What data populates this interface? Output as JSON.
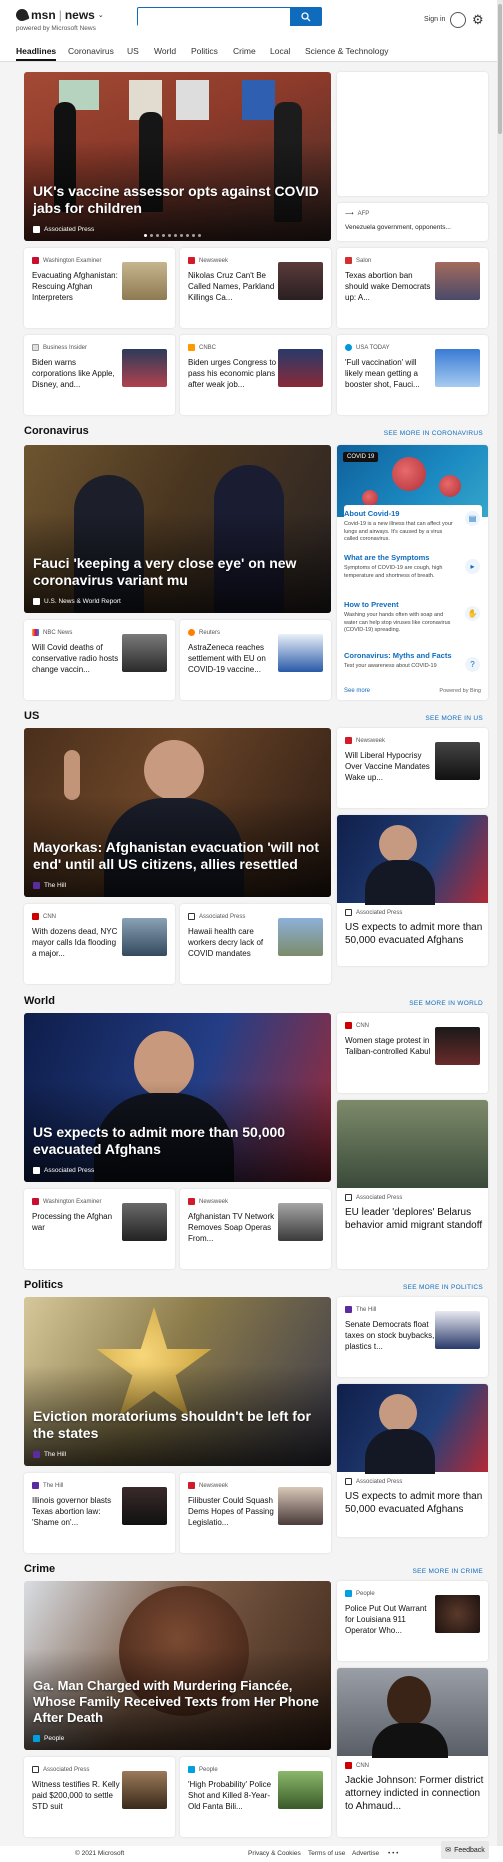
{
  "header": {
    "brand": "msn",
    "section": "news",
    "powered": "powered by Microsoft News",
    "search_placeholder": "",
    "signin": "Sign in"
  },
  "nav": [
    "Headlines",
    "Coronavirus",
    "US",
    "World",
    "Politics",
    "Crime",
    "Local",
    "Science & Technology"
  ],
  "top": {
    "hero": {
      "title": "UK's vaccine assessor opts against COVID jabs for children",
      "source": "Associated Press"
    },
    "side": {
      "source": "AFP",
      "title": "Venezuela government, opponents..."
    },
    "cards": [
      {
        "source": "Washington Examiner",
        "title": "Evacuating Afghanistan: Rescuing Afghan Interpreters"
      },
      {
        "source": "Newsweek",
        "title": "Nikolas Cruz Can't Be Called Names, Parkland Killings Ca..."
      },
      {
        "source": "Salon",
        "title": "Texas abortion ban should wake Democrats up: A..."
      },
      {
        "source": "Business Insider",
        "title": "Biden warns corporations like Apple, Disney, and..."
      },
      {
        "source": "CNBC",
        "title": "Biden urges Congress to pass his economic plans after weak job..."
      },
      {
        "source": "USA TODAY",
        "title": "'Full vaccination' will likely mean getting a booster shot, Fauci..."
      }
    ]
  },
  "coronavirus": {
    "heading": "Coronavirus",
    "more": "SEE MORE IN CORONAVIRUS",
    "hero": {
      "title": "Fauci 'keeping a very close eye' on new coronavirus variant mu",
      "source": "U.S. News & World Report"
    },
    "cards": [
      {
        "source": "NBC News",
        "title": "Will Covid deaths of conservative radio hosts change vaccin..."
      },
      {
        "source": "Reuters",
        "title": "AstraZeneca reaches settlement with EU on COVID-19 vaccine..."
      }
    ],
    "panel": {
      "badge": "COVID 19",
      "items": [
        {
          "title": "About Covid-19",
          "desc": "Covid-19 is a new illness that can affect your lungs and airways. It's caused by a virus called coronavirus."
        },
        {
          "title": "What are the Symptoms",
          "desc": "Symptoms of COVID-19 are cough, high temperature and shortness of breath."
        },
        {
          "title": "How to Prevent",
          "desc": "Washing your hands often with soap and water can help stop viruses like coronavirus (COVID-19) spreading."
        },
        {
          "title": "Coronavirus: Myths and Facts",
          "desc": "Test your awareness about COVID-19"
        }
      ],
      "see_more": "See more",
      "powered": "Powered by Bing"
    }
  },
  "us": {
    "heading": "US",
    "more": "SEE MORE IN US",
    "hero": {
      "title": "Mayorkas: Afghanistan evacuation 'will not end' until all US citizens, allies resettled",
      "source": "The Hill"
    },
    "side1": {
      "source": "Newsweek",
      "title": "Will Liberal Hypocrisy Over Vaccine Mandates Wake up..."
    },
    "side2": {
      "source": "Associated Press",
      "title": "US expects to admit more than 50,000 evacuated Afghans"
    },
    "cards": [
      {
        "source": "CNN",
        "title": "With dozens dead, NYC mayor calls Ida flooding a major..."
      },
      {
        "source": "Associated Press",
        "title": "Hawaii health care workers decry lack of COVID mandates"
      }
    ]
  },
  "world": {
    "heading": "World",
    "more": "SEE MORE IN WORLD",
    "hero": {
      "title": "US expects to admit more than 50,000 evacuated Afghans",
      "source": "Associated Press"
    },
    "side1": {
      "source": "CNN",
      "title": "Women stage protest in Taliban-controlled Kabul"
    },
    "side2": {
      "source": "Associated Press",
      "title": "EU leader 'deplores' Belarus behavior amid migrant standoff"
    },
    "cards": [
      {
        "source": "Washington Examiner",
        "title": "Processing the Afghan war"
      },
      {
        "source": "Newsweek",
        "title": "Afghanistan TV Network Removes Soap Operas From..."
      }
    ]
  },
  "politics": {
    "heading": "Politics",
    "more": "SEE MORE IN POLITICS",
    "hero": {
      "title": "Eviction moratoriums shouldn't be left for the states",
      "source": "The Hill"
    },
    "side1": {
      "source": "The Hill",
      "title": "Senate Democrats float taxes on stock buybacks, plastics t..."
    },
    "side2": {
      "source": "Associated Press",
      "title": "US expects to admit more than 50,000 evacuated Afghans"
    },
    "cards": [
      {
        "source": "The Hill",
        "title": "Illinois governor blasts Texas abortion law: 'Shame on'..."
      },
      {
        "source": "Newsweek",
        "title": "Filibuster Could Squash Dems Hopes of Passing Legislatio..."
      }
    ]
  },
  "crime": {
    "heading": "Crime",
    "more": "SEE MORE IN CRIME",
    "hero": {
      "title": "Ga. Man Charged with Murdering Fiancée, Whose Family Received Texts from Her Phone After Death",
      "source": "People"
    },
    "side1": {
      "source": "People",
      "title": "Police Put Out Warrant for Louisiana 911 Operator Who..."
    },
    "side2": {
      "source": "CNN",
      "title": "Jackie Johnson: Former district attorney indicted in connection to Ahmaud..."
    },
    "cards": [
      {
        "source": "Associated Press",
        "title": "Witness testifies R. Kelly paid $200,000 to settle STD suit"
      },
      {
        "source": "People",
        "title": "'High Probability' Police Shot and Killed 8-Year-Old Fanta Bili..."
      }
    ]
  },
  "footer": {
    "copyright": "© 2021 Microsoft",
    "privacy": "Privacy & Cookies",
    "terms": "Terms of use",
    "advertise": "Advertise",
    "more": "• • •",
    "feedback": "Feedback"
  }
}
